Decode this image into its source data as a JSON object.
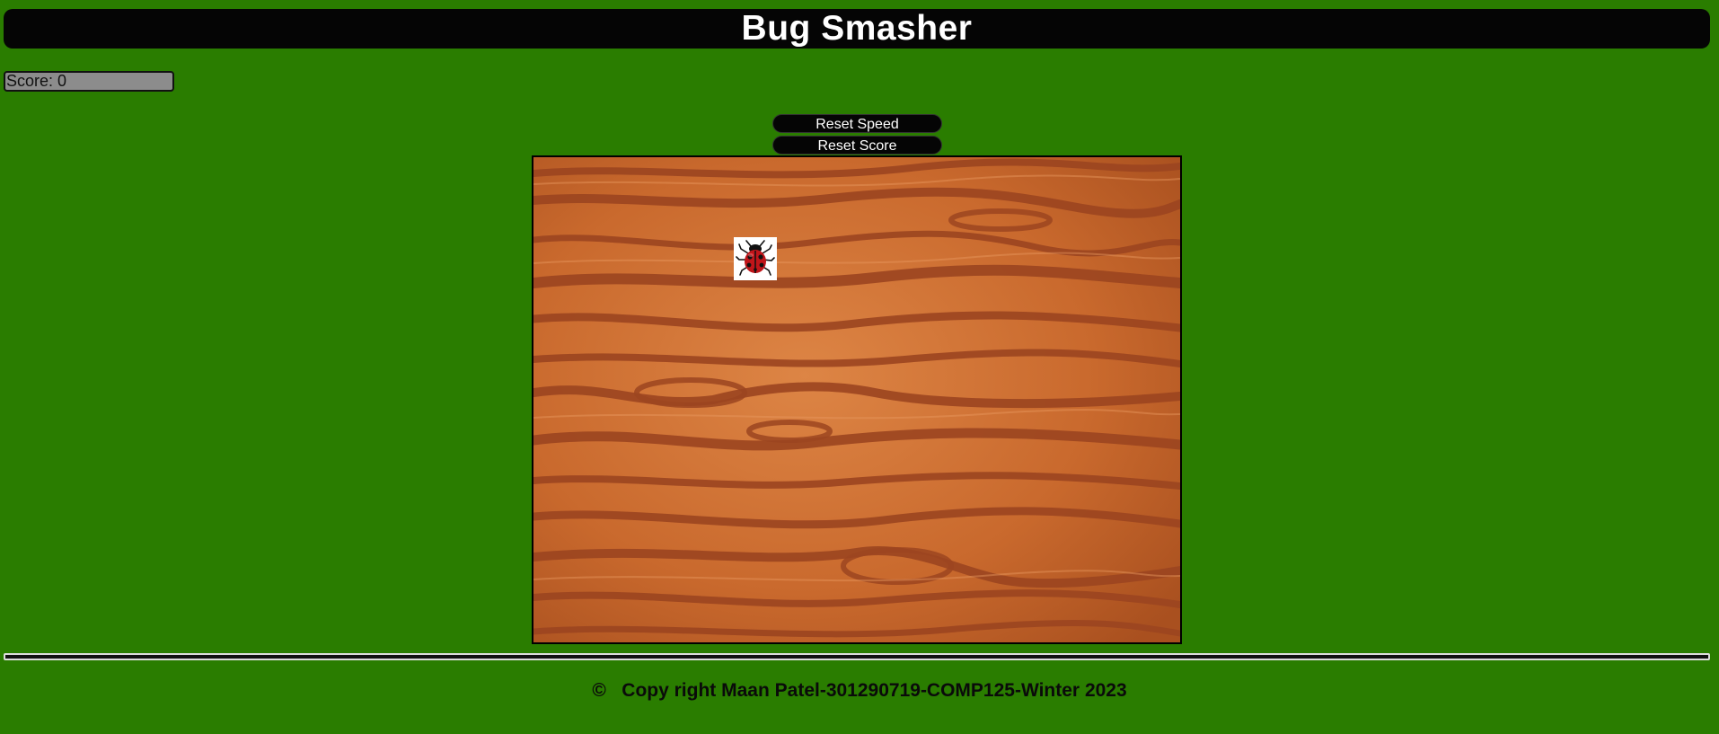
{
  "header": {
    "title": "Bug Smasher"
  },
  "scoreboard": {
    "score_text": "Score: 0"
  },
  "controls": {
    "reset_speed_label": "Reset Speed",
    "reset_score_label": "Reset Score"
  },
  "game": {
    "board_background": "wood-grain",
    "bug_icon": "ladybug-icon"
  },
  "footer": {
    "copyright_text": "©   Copy right Maan Patel-301290719-COMP125-Winter 2023"
  },
  "colors": {
    "page_background": "#2a7d00",
    "title_bar": "#050505",
    "score_box": "#8c8c8c",
    "button": "#050505",
    "wood_base": "#c6672c",
    "wood_grain": "#9c4520",
    "bug_body": "#c0151a"
  }
}
